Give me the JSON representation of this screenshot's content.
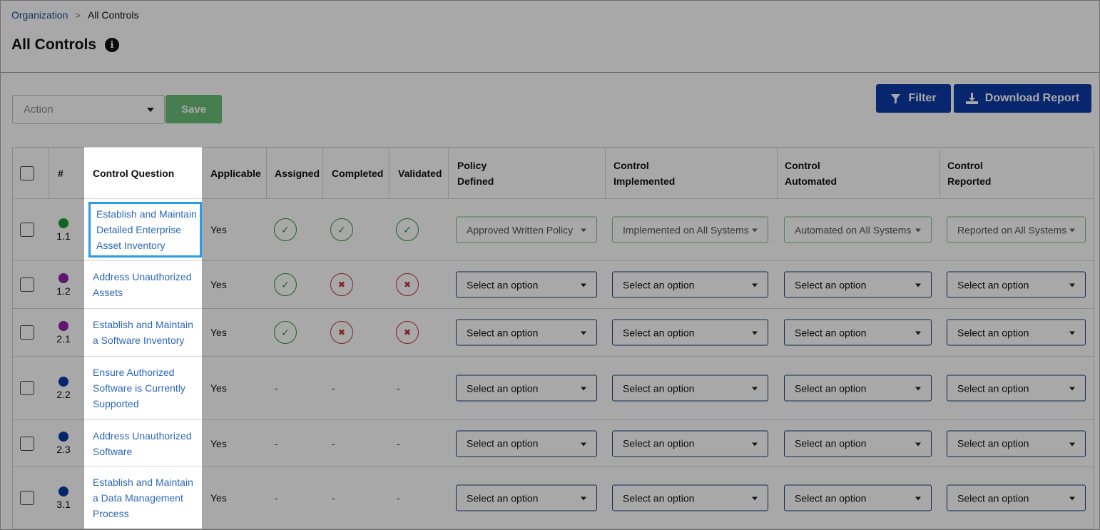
{
  "breadcrumb": {
    "parent": "Organization",
    "separator": ">",
    "current": "All Controls"
  },
  "page": {
    "title": "All Controls",
    "info_icon": "info-icon"
  },
  "toolbar": {
    "action_placeholder": "Action",
    "save_label": "Save",
    "filter_label": "Filter",
    "download_label": "Download Report"
  },
  "table": {
    "headers": {
      "number": "#",
      "question": "Control Question",
      "applicable": "Applicable",
      "assigned": "Assigned",
      "completed": "Completed",
      "validated": "Validated",
      "policy_l1": "Policy",
      "policy_l2": "Defined",
      "implemented_l1": "Control",
      "implemented_l2": "Implemented",
      "automated_l1": "Control",
      "automated_l2": "Automated",
      "reported_l1": "Control",
      "reported_l2": "Reported"
    },
    "rows": [
      {
        "num": "1.1",
        "dot": "#1e9a34",
        "q1": "Establish and Maintain",
        "q2": "Detailed Enterprise",
        "q3": "Asset Inventory",
        "applicable": "Yes",
        "assigned": "check",
        "completed": "check",
        "validated": "check",
        "policy": "Approved Written Policy",
        "implemented": "Implemented on All Systems",
        "automated": "Automated on All Systems",
        "reported": "Reported on All Systems"
      },
      {
        "num": "1.2",
        "dot": "#8e24aa",
        "q1": "Address Unauthorized",
        "q2": "Assets",
        "q3": "",
        "applicable": "Yes",
        "assigned": "check",
        "completed": "x",
        "validated": "x",
        "policy": "Select an option",
        "implemented": "Select an option",
        "automated": "Select an option",
        "reported": "Select an option"
      },
      {
        "num": "2.1",
        "dot": "#8e24aa",
        "q1": "Establish and Maintain",
        "q2": "a Software Inventory",
        "q3": "",
        "applicable": "Yes",
        "assigned": "check",
        "completed": "x",
        "validated": "x",
        "policy": "Select an option",
        "implemented": "Select an option",
        "automated": "Select an option",
        "reported": "Select an option"
      },
      {
        "num": "2.2",
        "dot": "#0d3aa8",
        "q1": "Ensure Authorized",
        "q2": "Software is Currently",
        "q3": "Supported",
        "applicable": "Yes",
        "assigned": "-",
        "completed": "-",
        "validated": "-",
        "policy": "Select an option",
        "implemented": "Select an option",
        "automated": "Select an option",
        "reported": "Select an option"
      },
      {
        "num": "2.3",
        "dot": "#0d3aa8",
        "q1": "Address Unauthorized",
        "q2": "Software",
        "q3": "",
        "applicable": "Yes",
        "assigned": "-",
        "completed": "-",
        "validated": "-",
        "policy": "Select an option",
        "implemented": "Select an option",
        "automated": "Select an option",
        "reported": "Select an option"
      },
      {
        "num": "3.1",
        "dot": "#0d3aa8",
        "q1": "Establish and Maintain",
        "q2": "a Data Management",
        "q3": "Process",
        "applicable": "Yes",
        "assigned": "-",
        "completed": "-",
        "validated": "-",
        "policy": "Select an option",
        "implemented": "Select an option",
        "automated": "Select an option",
        "reported": "Select an option"
      }
    ]
  },
  "icons": {
    "check": "✓",
    "x": "✖",
    "filter": "filter-icon",
    "download": "download-icon"
  }
}
